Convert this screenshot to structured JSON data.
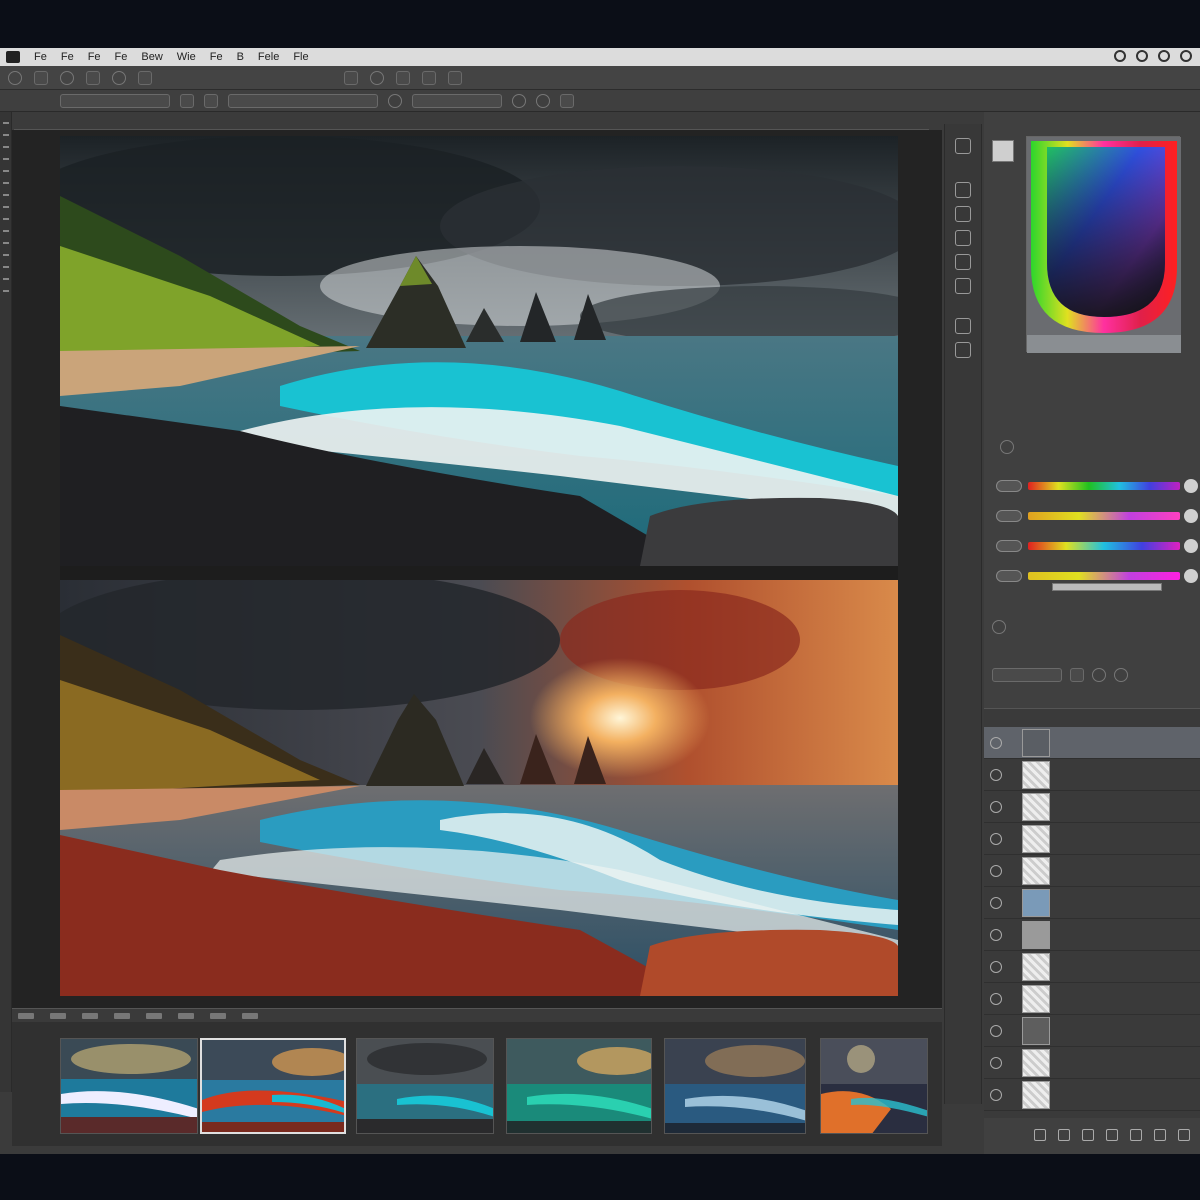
{
  "menubar": {
    "items": [
      "Fe",
      "Fe",
      "Fe",
      "Fe",
      "Bew",
      "Wie",
      "Fe",
      "B",
      "Fele",
      "Fle"
    ]
  },
  "toolbar": {
    "buttons": [
      "",
      "",
      "",
      "",
      "",
      "",
      "",
      ""
    ],
    "options": [
      "",
      "",
      "",
      "",
      "",
      ""
    ]
  },
  "tabs": {
    "label": ""
  },
  "panel": {
    "tabs_label": "",
    "colors_label": "",
    "adjustments_label": "",
    "section_label": ""
  },
  "layers": {
    "header": "",
    "items": [
      {
        "name": "",
        "active": true
      },
      {
        "name": "",
        "active": false
      },
      {
        "name": "",
        "active": false
      },
      {
        "name": "",
        "active": false
      },
      {
        "name": "",
        "active": false
      },
      {
        "name": "",
        "active": false
      },
      {
        "name": "",
        "active": false
      },
      {
        "name": "",
        "active": false
      },
      {
        "name": "",
        "active": false
      },
      {
        "name": "",
        "active": false
      },
      {
        "name": "",
        "active": false
      },
      {
        "name": "",
        "active": false
      }
    ]
  },
  "colors": {
    "ui_bg": "#3b3b3b",
    "panel_bg": "#404040",
    "accent_sea": "#18b6c8",
    "accent_sunset": "#e0702a"
  },
  "filmstrip": {
    "count": 6,
    "selected_index": 1
  }
}
